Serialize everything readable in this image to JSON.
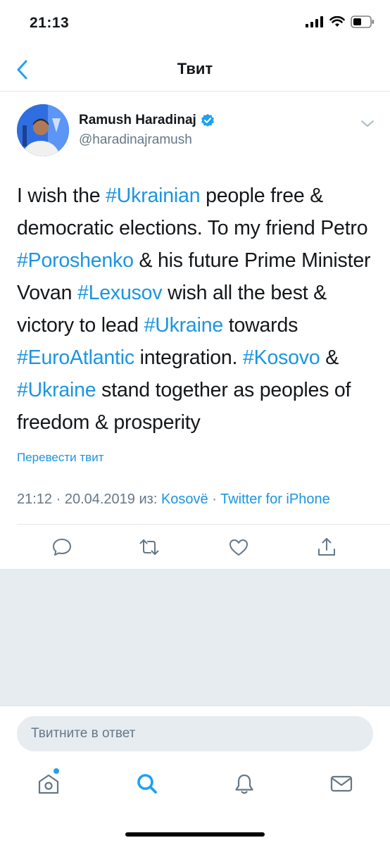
{
  "status": {
    "time": "21:13"
  },
  "nav": {
    "title": "Твит"
  },
  "author": {
    "name": "Ramush Haradinaj",
    "handle": "@haradinajramush"
  },
  "tweet": {
    "segments": [
      {
        "text": "I wish the ",
        "tag": false
      },
      {
        "text": "#Ukrainian",
        "tag": true
      },
      {
        "text": " people free & democratic elections. To my friend Petro ",
        "tag": false
      },
      {
        "text": "#Poroshenko",
        "tag": true
      },
      {
        "text": " & his future Prime Minister Vovan ",
        "tag": false
      },
      {
        "text": "#Lexusov",
        "tag": true
      },
      {
        "text": " wish all the best & victory to lead ",
        "tag": false
      },
      {
        "text": "#Ukraine",
        "tag": true
      },
      {
        "text": " towards ",
        "tag": false
      },
      {
        "text": "#EuroAtlantic",
        "tag": true
      },
      {
        "text": " integration. ",
        "tag": false
      },
      {
        "text": "#Kosovo",
        "tag": true
      },
      {
        "text": " & ",
        "tag": false
      },
      {
        "text": "#Ukraine",
        "tag": true
      },
      {
        "text": " stand together as peoples of freedom & prosperity",
        "tag": false
      }
    ],
    "translate_label": "Перевести твит"
  },
  "meta": {
    "time_date": "21:12 · 20.04.2019 из: ",
    "location": "Kosovë",
    "separator": " · ",
    "source": "Twitter for iPhone"
  },
  "reply": {
    "placeholder": "Твитните в ответ"
  },
  "icons": {
    "back": "chevron-left-icon",
    "verified": "verified-badge-icon",
    "caret": "chevron-down-icon",
    "actions": [
      "reply-icon",
      "retweet-icon",
      "like-icon",
      "share-icon"
    ],
    "tabs": [
      "home-icon",
      "search-icon",
      "notifications-icon",
      "messages-icon"
    ]
  },
  "colors": {
    "accent": "#1da1f2",
    "link": "#1b95e0",
    "secondary_text": "#657786",
    "divider": "#e1e8ed",
    "background_gray": "#e6ecf0"
  }
}
